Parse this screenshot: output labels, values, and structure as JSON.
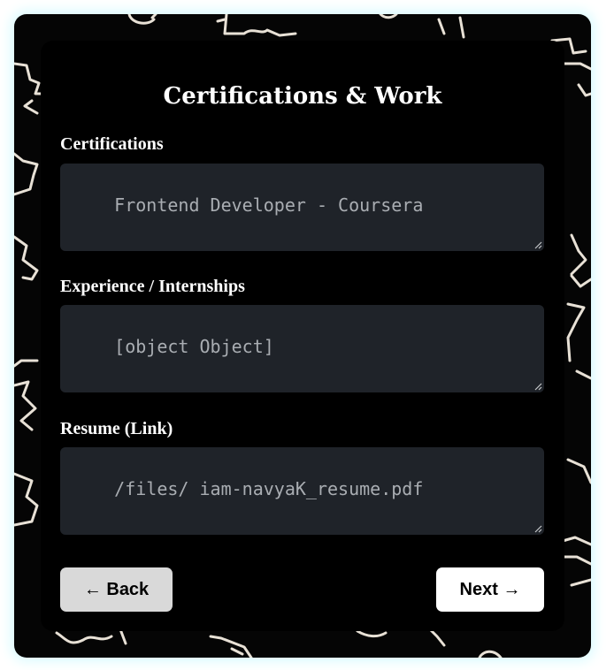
{
  "form": {
    "title": "Certifications & Work",
    "fields": [
      {
        "label": "Certifications",
        "placeholder": "Frontend Developer - Coursera"
      },
      {
        "label": "Experience / Internships",
        "placeholder": "[object Object]"
      },
      {
        "label": "Resume (Link)",
        "placeholder": "/files/ iam-navyaK_resume.pdf"
      }
    ],
    "back_label": "← Back",
    "next_label": "Next →"
  },
  "colors": {
    "background": "#050505",
    "card": "#000000",
    "input_bg": "#1f2329",
    "glow": "#d9fbff",
    "back_button": "#d9d9d9",
    "next_button": "#ffffff"
  }
}
